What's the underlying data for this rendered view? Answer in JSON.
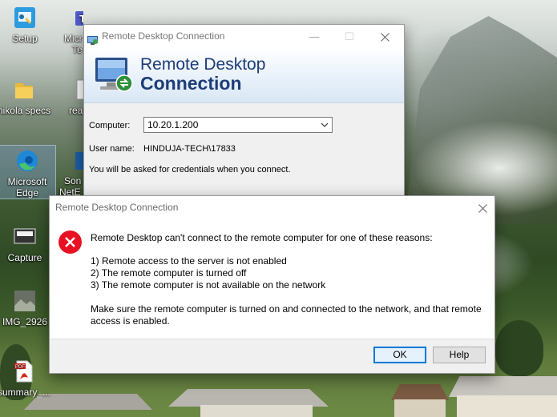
{
  "desktop": {
    "icons": [
      {
        "label": "Setup"
      },
      {
        "label": "Micr"
      },
      {
        "label": "Te"
      },
      {
        "label": "nikola specs"
      },
      {
        "label": "rea"
      },
      {
        "label": "Microsoft Edge"
      },
      {
        "label": "Son"
      },
      {
        "label": "NetE"
      },
      {
        "label": "Capture"
      },
      {
        "label": "IMG_2926"
      },
      {
        "label": "summary_..."
      }
    ]
  },
  "rdc_window": {
    "title": "Remote Desktop Connection",
    "banner_line1": "Remote Desktop",
    "banner_line2": "Connection",
    "computer_label": "Computer:",
    "computer_value": "10.20.1.200",
    "username_label": "User name:",
    "username_value": "HINDUJA-TECH\\17833",
    "credentials_note": "You will be asked for credentials when you connect."
  },
  "error_dialog": {
    "title": "Remote Desktop Connection",
    "intro": "Remote Desktop can't connect to the remote computer for one of these reasons:",
    "reasons": [
      "1) Remote access to the server is not enabled",
      "2) The remote computer is turned off",
      "3) The remote computer is not available on the network"
    ],
    "advice": "Make sure the remote computer is turned on and connected to the network, and that remote access is enabled.",
    "ok_label": "OK",
    "help_label": "Help"
  },
  "colors": {
    "accent": "#0078d7",
    "error_red": "#e81123",
    "banner_text": "#1d3c78"
  },
  "icons": {
    "close": "close-icon",
    "minimize": "minimize-icon",
    "maximize": "maximize-icon",
    "error": "error-icon",
    "dropdown": "chevron-down-icon"
  }
}
